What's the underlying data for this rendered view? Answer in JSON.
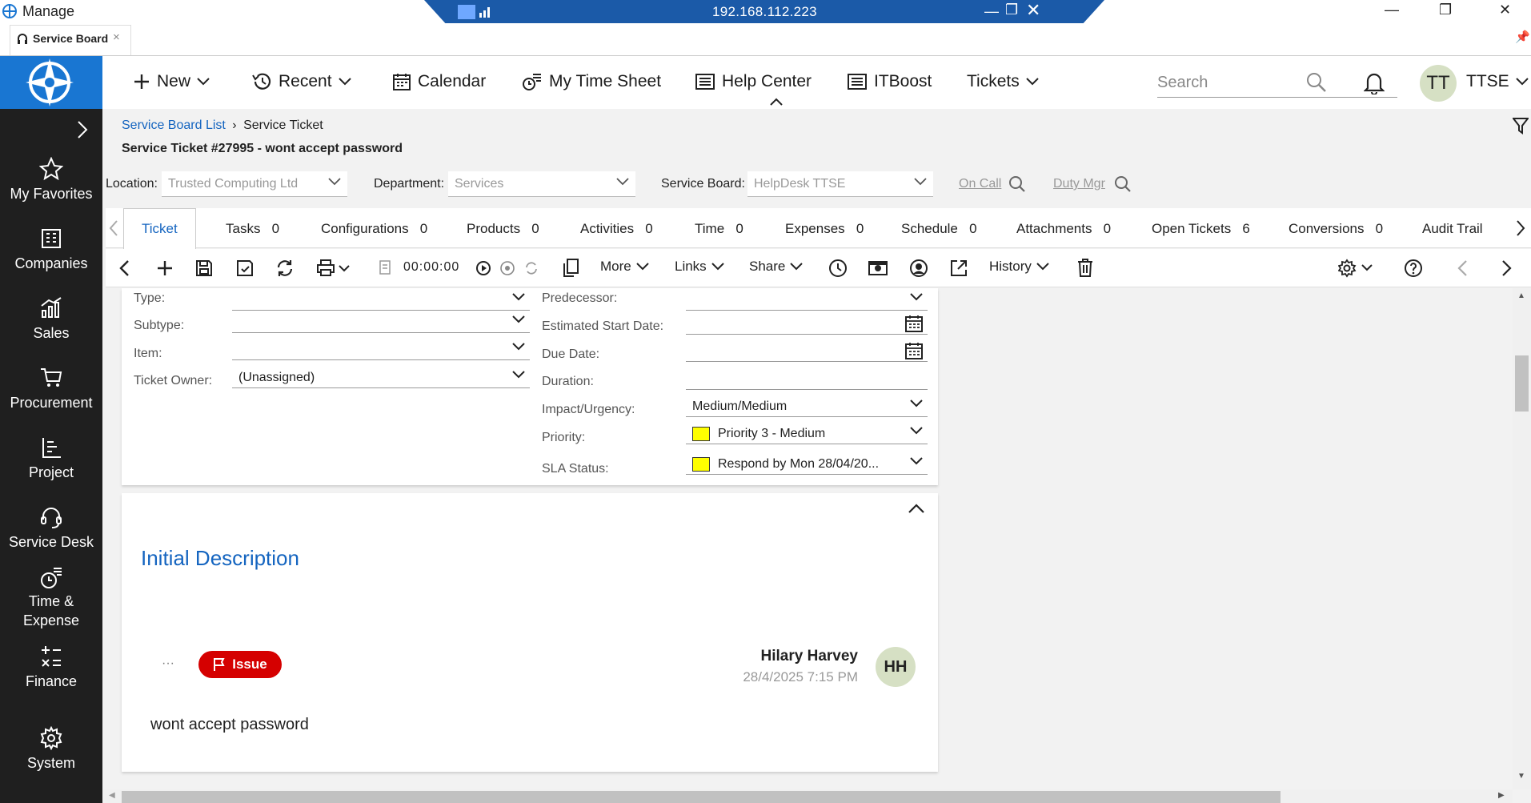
{
  "window": {
    "title": "Manage",
    "remote_ip": "192.168.112.223"
  },
  "browser_tab": {
    "label": "Service Board",
    "close": "×"
  },
  "nav": {
    "items": [
      {
        "label": "My Favorites",
        "icon": "star-icon"
      },
      {
        "label": "Companies",
        "icon": "building-icon"
      },
      {
        "label": "Sales",
        "icon": "chart-icon"
      },
      {
        "label": "Procurement",
        "icon": "cart-icon"
      },
      {
        "label": "Project",
        "icon": "project-icon"
      },
      {
        "label": "Service Desk",
        "icon": "headset-icon"
      },
      {
        "label": "Time & Expense",
        "icon": "time-expense-icon"
      },
      {
        "label": "Finance",
        "icon": "finance-icon"
      },
      {
        "label": "System",
        "icon": "gear-icon"
      }
    ]
  },
  "appbar": {
    "new": "New",
    "recent": "Recent",
    "calendar": "Calendar",
    "timesheet": "My Time Sheet",
    "help": "Help Center",
    "itboost": "ITBoost",
    "tickets": "Tickets",
    "search_placeholder": "Search",
    "avatar": "TT",
    "user": "TTSE"
  },
  "breadcrumb": {
    "parent": "Service Board List",
    "current": "Service Ticket"
  },
  "ticket_title": "Service Ticket #27995 - wont accept password",
  "header_fields": {
    "location_label": "Location:",
    "location_value": "Trusted Computing Ltd",
    "department_label": "Department:",
    "department_value": "Services",
    "board_label": "Service Board:",
    "board_value": "HelpDesk TTSE",
    "on_call": "On Call",
    "duty_mgr": "Duty Mgr"
  },
  "tabs": [
    {
      "label": "Ticket",
      "count": ""
    },
    {
      "label": "Tasks",
      "count": "0"
    },
    {
      "label": "Configurations",
      "count": "0"
    },
    {
      "label": "Products",
      "count": "0"
    },
    {
      "label": "Activities",
      "count": "0"
    },
    {
      "label": "Time",
      "count": "0"
    },
    {
      "label": "Expenses",
      "count": "0"
    },
    {
      "label": "Schedule",
      "count": "0"
    },
    {
      "label": "Attachments",
      "count": "0"
    },
    {
      "label": "Open Tickets",
      "count": "6"
    },
    {
      "label": "Conversions",
      "count": "0"
    },
    {
      "label": "Audit Trail",
      "count": ""
    }
  ],
  "toolbar": {
    "timer": "00:00:00",
    "more": "More",
    "links": "Links",
    "share": "Share",
    "history": "History"
  },
  "ticket_fields": {
    "type_label": "Type:",
    "subtype_label": "Subtype:",
    "item_label": "Item:",
    "owner_label": "Ticket Owner:",
    "owner_value": "(Unassigned)",
    "predecessor_label": "Predecessor:",
    "start_label": "Estimated Start Date:",
    "due_label": "Due Date:",
    "duration_label": "Duration:",
    "impact_label": "Impact/Urgency:",
    "impact_value": "Medium/Medium",
    "priority_label": "Priority:",
    "priority_value": "Priority 3 - Medium",
    "sla_label": "SLA Status:",
    "sla_value": "Respond by Mon 28/04/20...",
    "priority_color": "#ffff00"
  },
  "description": {
    "heading": "Initial Description",
    "badge": "Issue",
    "author": "Hilary Harvey",
    "timestamp": "28/4/2025 7:15 PM",
    "avatar": "HH",
    "text": "wont accept password",
    "menu": "···"
  },
  "colors": {
    "accent": "#1565c0",
    "nav_bg": "#1f1f1f",
    "logo_bg": "#1976d2",
    "issue_red": "#d50000"
  }
}
